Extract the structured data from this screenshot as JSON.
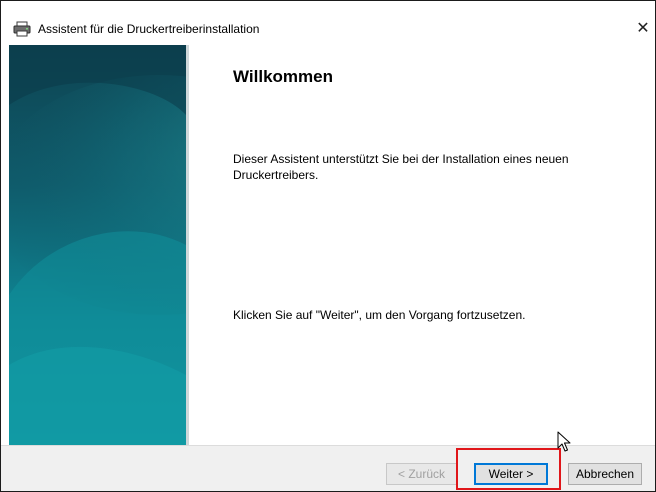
{
  "window": {
    "title": "Assistent für die Druckertreiberinstallation",
    "close_glyph": "✕",
    "title_icon": "printer-icon"
  },
  "content": {
    "heading": "Willkommen",
    "intro": "Dieser Assistent unterstützt Sie bei der Installation eines neuen Druckertreibers.",
    "hint": "Klicken Sie auf \"Weiter\", um den Vorgang fortzusetzen."
  },
  "buttons": {
    "back": "< Zurück",
    "next": "Weiter >",
    "cancel": "Abbrechen"
  },
  "colors": {
    "sidebar_dark": "#0f4f5c",
    "sidebar_light": "#10949f",
    "default_button_border": "#0078d7",
    "highlight": "#e0161a"
  },
  "state": {
    "back_enabled": false,
    "highlighted_button": "next"
  }
}
